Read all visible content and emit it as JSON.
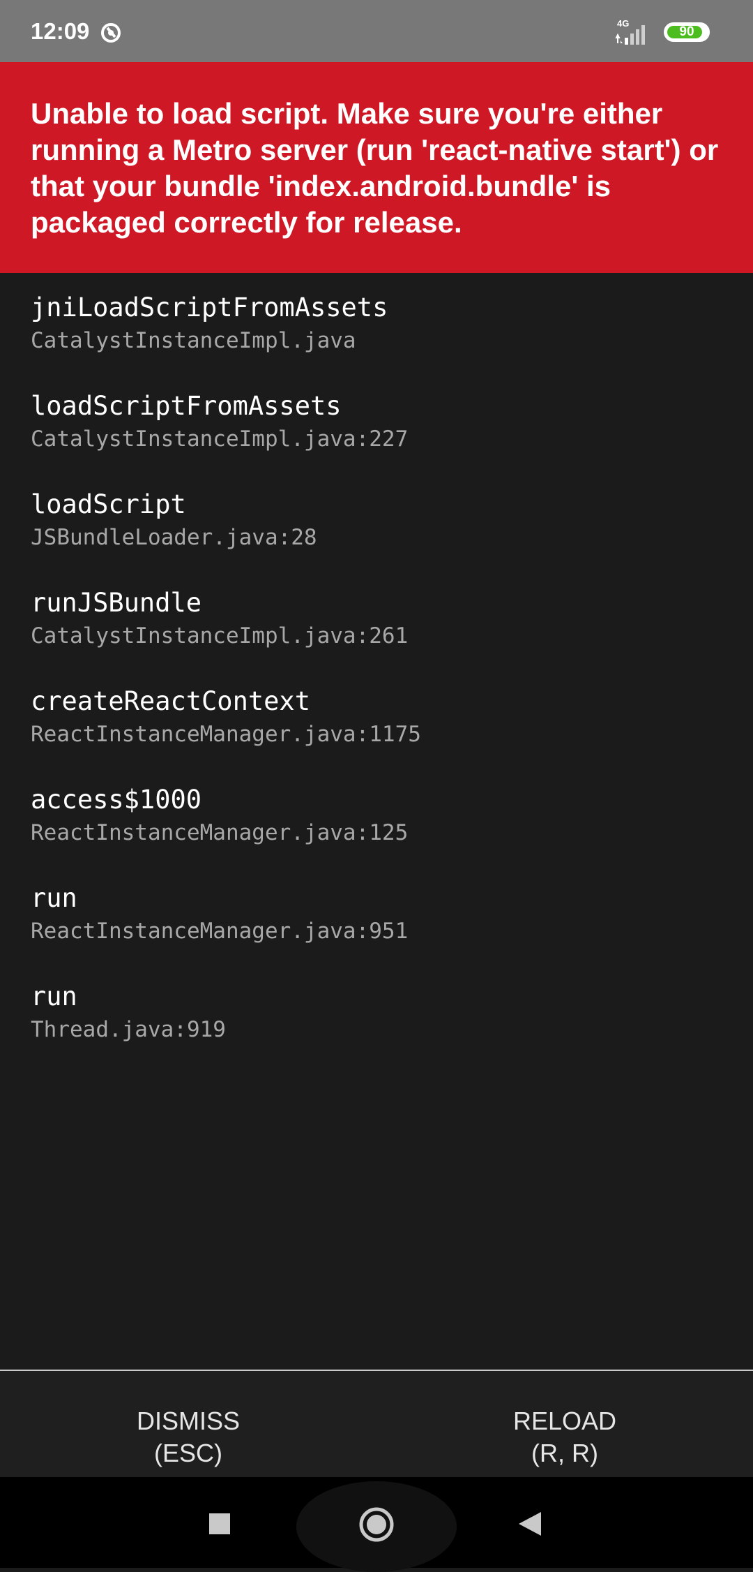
{
  "status_bar": {
    "time": "12:09",
    "network": "4G",
    "battery": "90",
    "battery_level_percent": 90,
    "colors": {
      "background": "#787878",
      "battery": "#4cbd1e"
    }
  },
  "error": {
    "message": "Unable to load script. Make sure you're either running a Metro server (run 'react-native start') or that your bundle 'index.android.bundle' is packaged correctly for release.",
    "background_color": "#cf1826"
  },
  "stack_frames": [
    {
      "method": "jniLoadScriptFromAssets",
      "file": "CatalystInstanceImpl.java"
    },
    {
      "method": "loadScriptFromAssets",
      "file": "CatalystInstanceImpl.java:227"
    },
    {
      "method": "loadScript",
      "file": "JSBundleLoader.java:28"
    },
    {
      "method": "runJSBundle",
      "file": "CatalystInstanceImpl.java:261"
    },
    {
      "method": "createReactContext",
      "file": "ReactInstanceManager.java:1175"
    },
    {
      "method": "access$1000",
      "file": "ReactInstanceManager.java:125"
    },
    {
      "method": "run",
      "file": "ReactInstanceManager.java:951"
    },
    {
      "method": "run",
      "file": "Thread.java:919"
    }
  ],
  "actions": {
    "dismiss": {
      "label": "DISMISS",
      "shortcut": "(ESC)"
    },
    "reload": {
      "label": "RELOAD",
      "shortcut": "(R, R)"
    }
  },
  "nav_bar": {
    "icons": [
      "recents-square-icon",
      "home-circle-icon",
      "back-triangle-icon"
    ]
  }
}
